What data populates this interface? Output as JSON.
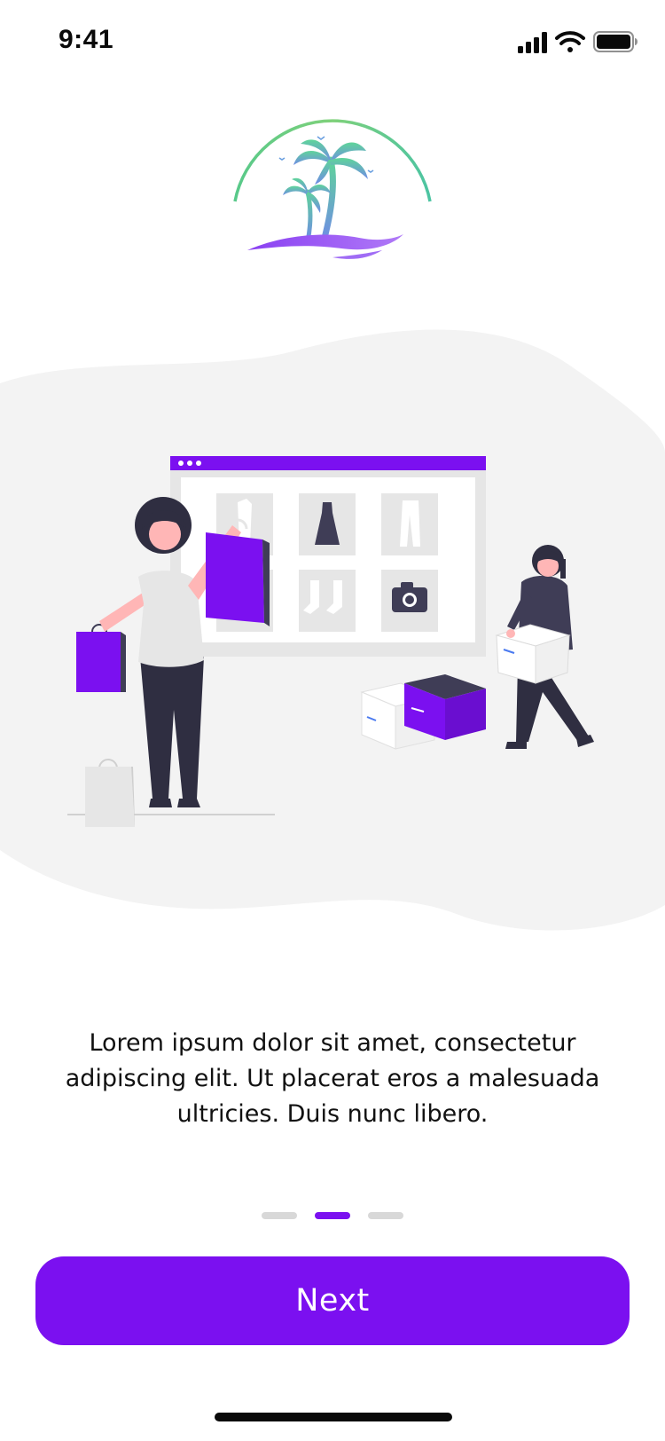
{
  "status_bar": {
    "time": "9:41",
    "icons": [
      "cellular-signal-icon",
      "wifi-icon",
      "battery-icon"
    ]
  },
  "logo": {
    "icon": "palm-tree-island-logo-icon"
  },
  "illustration": {
    "icon": "online-shopping-illustration",
    "blob_color": "#f3f3f3",
    "accent_color": "#7b10f0"
  },
  "content": {
    "description": "Lorem ipsum dolor sit amet, consectetur adipiscing elit. Ut placerat eros a malesuada ultricies. Duis nunc libero."
  },
  "pager": {
    "total": 3,
    "active_index": 1
  },
  "actions": {
    "next_label": "Next"
  },
  "colors": {
    "accent": "#7b10f0",
    "inactive_dot": "#d8d8d8",
    "text": "#111111"
  }
}
